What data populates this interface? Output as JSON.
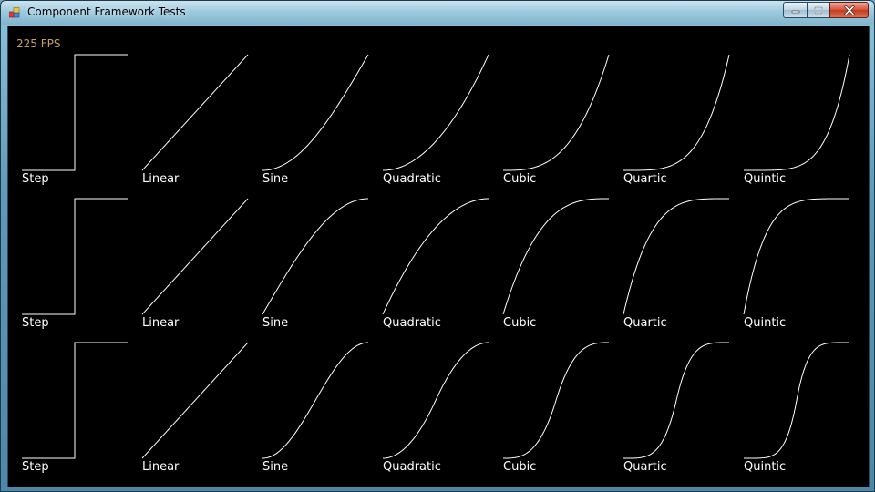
{
  "window": {
    "title": "Component Framework Tests",
    "minimize_icon": "minimize-icon",
    "maximize_icon": "maximize-icon",
    "close_icon": "close-icon",
    "app_icon": "app-icon"
  },
  "fps_label": "225 FPS",
  "colors": {
    "background": "#000000",
    "curve": "#ffffff",
    "fps_text": "#c8a060"
  },
  "easings": [
    "Step",
    "Linear",
    "Sine",
    "Quadratic",
    "Cubic",
    "Quartic",
    "Quintic"
  ],
  "rows": [
    {
      "mode": "in"
    },
    {
      "mode": "out"
    },
    {
      "mode": "in-out"
    }
  ]
}
